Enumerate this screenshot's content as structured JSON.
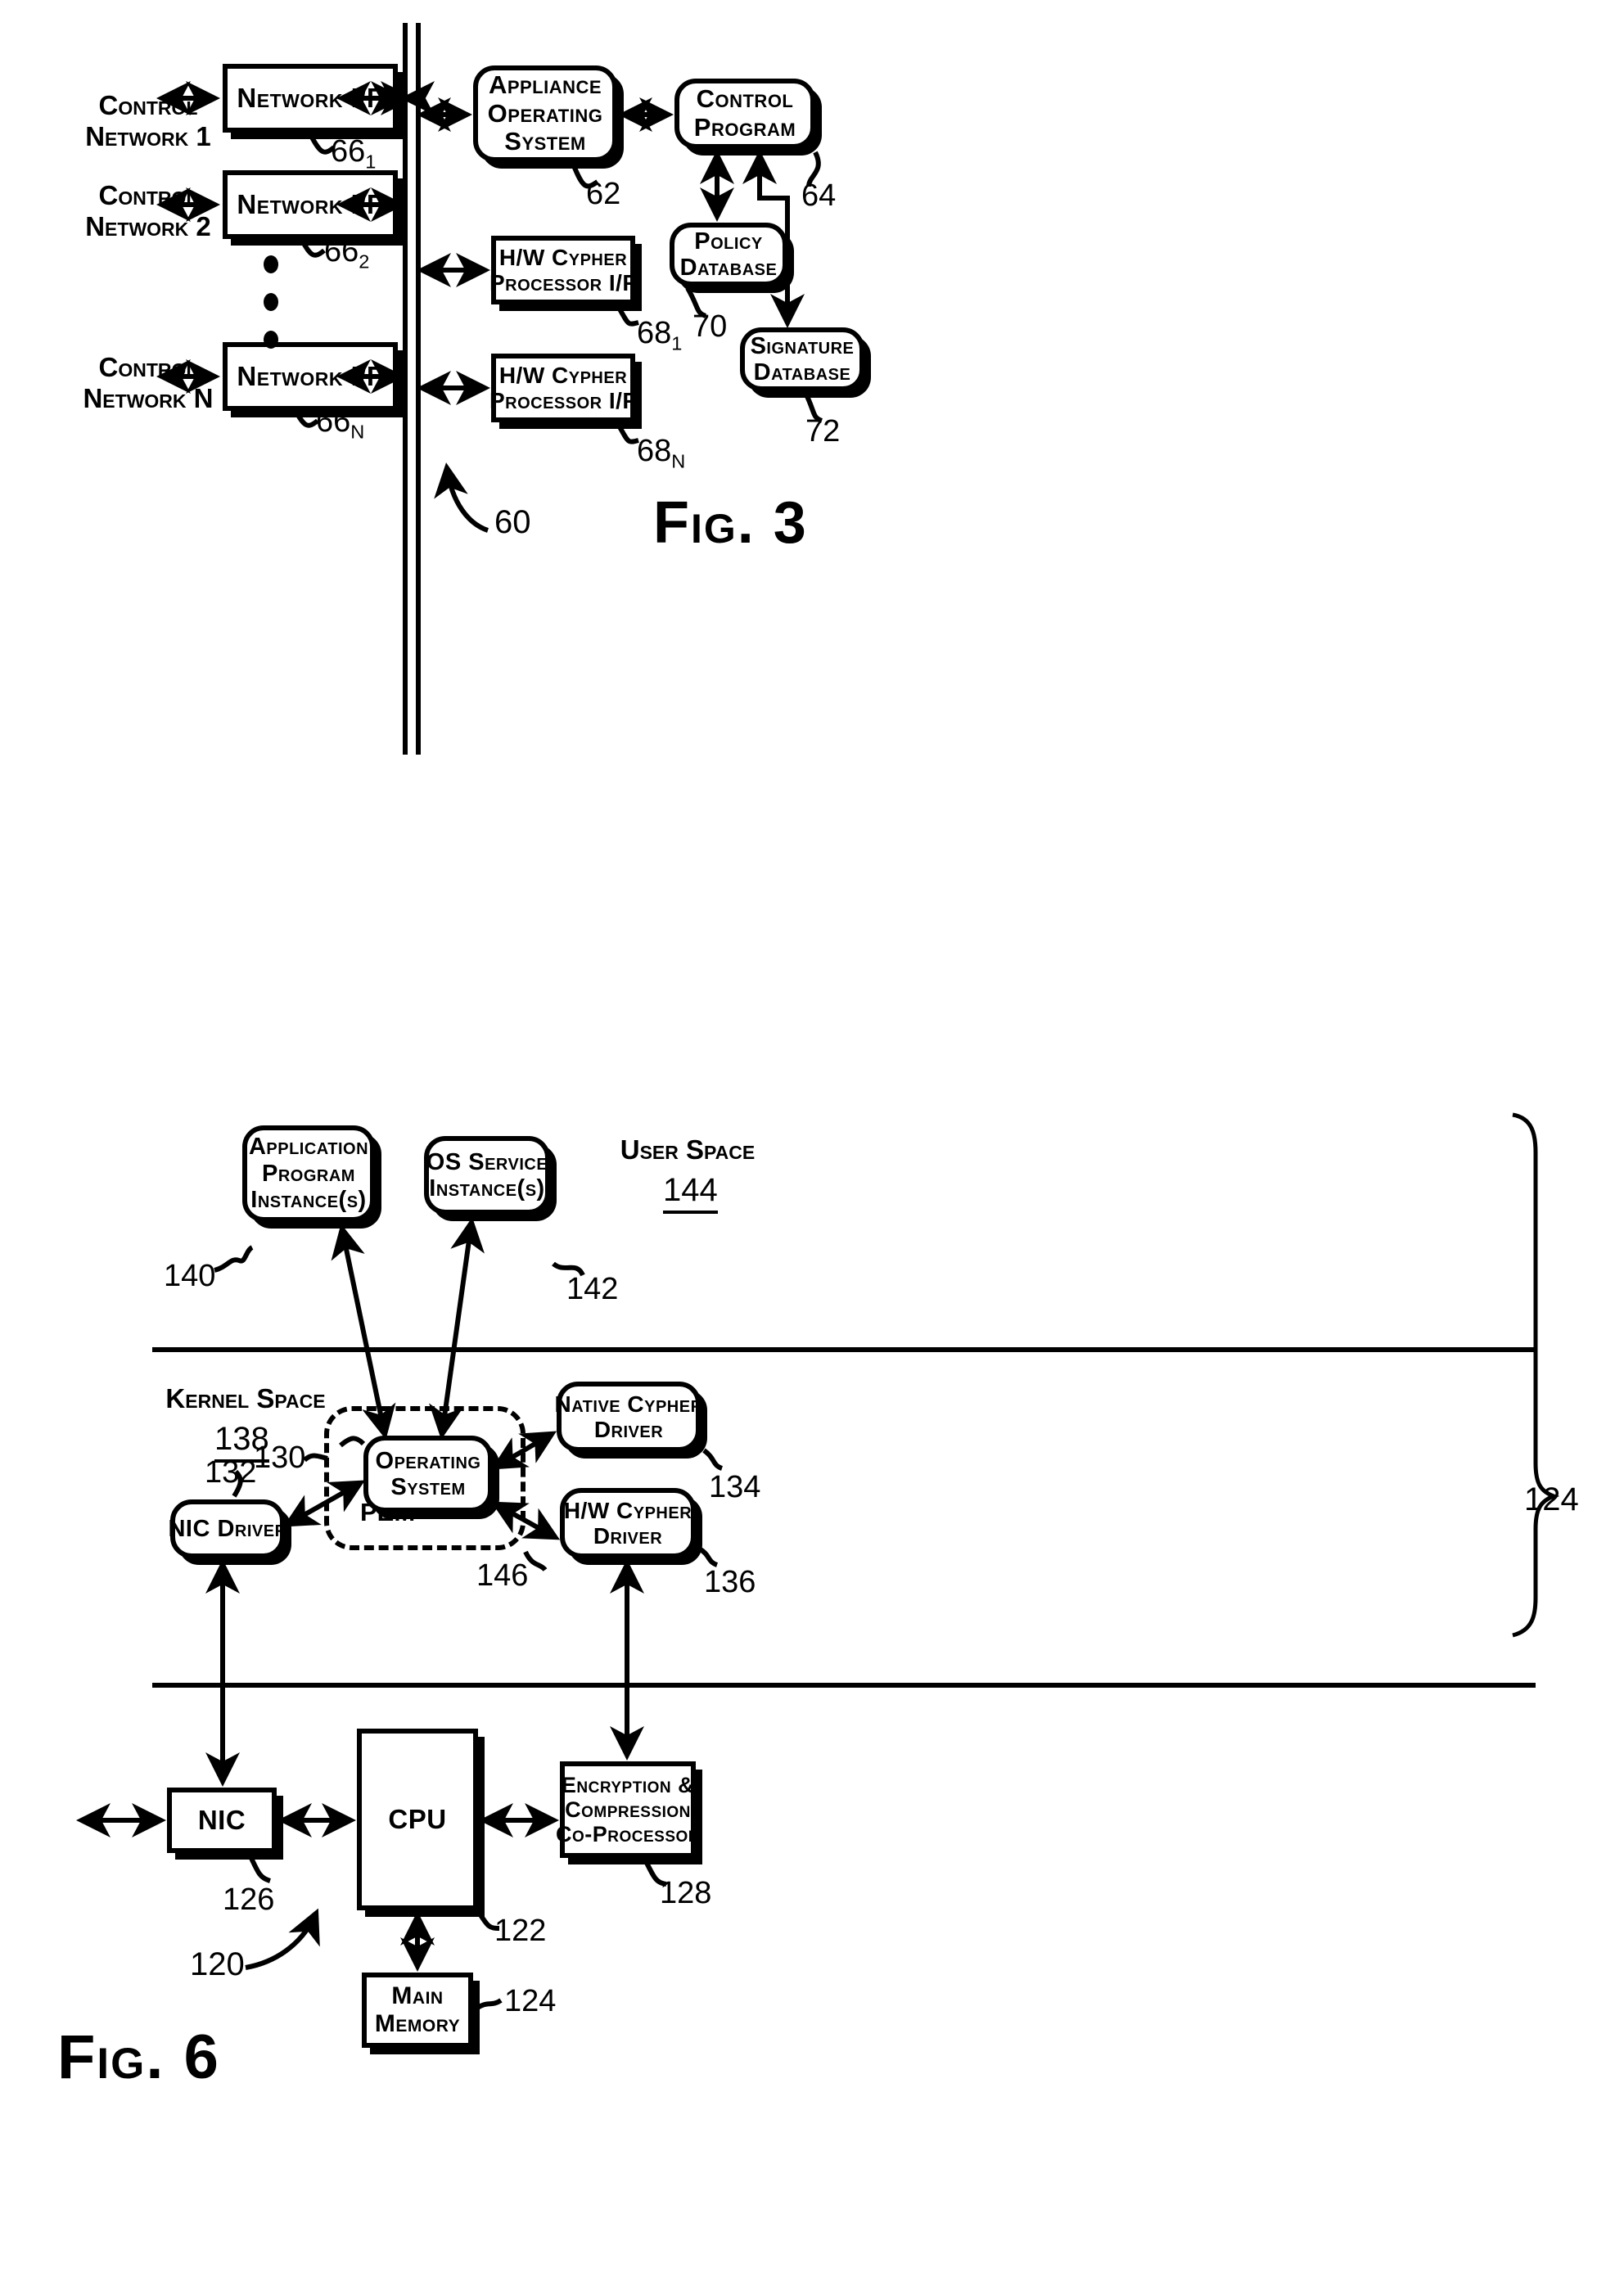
{
  "figures": [
    {
      "id": "fig3",
      "caption": "Fig. 3",
      "system_ref": "60",
      "left_labels": [
        {
          "line1": "Control",
          "line2": "Network 1"
        },
        {
          "line1": "Control",
          "line2": "Network 2"
        },
        {
          "line1": "Control",
          "line2": "Network N"
        }
      ],
      "network_if": [
        {
          "label": "Network I/F",
          "ref": "66",
          "sub": "1"
        },
        {
          "label": "Network I/F",
          "ref": "66",
          "sub": "2"
        },
        {
          "label": "Network I/F",
          "ref": "66",
          "sub": "N"
        }
      ],
      "blocks": {
        "appliance_os": {
          "line1": "Appliance",
          "line2": "Operating",
          "line3": "System",
          "ref": "62"
        },
        "control_program": {
          "line1": "Control",
          "line2": "Program",
          "ref": "64"
        },
        "policy_database": {
          "line1": "Policy",
          "line2": "Database",
          "ref": "70"
        },
        "signature_database": {
          "line1": "Signature",
          "line2": "Database",
          "ref": "72"
        },
        "hw_cypher_1": {
          "line1": "H/W Cypher",
          "line2": "Processor I/F",
          "ref": "68",
          "sub": "1"
        },
        "hw_cypher_n": {
          "line1": "H/W Cypher",
          "line2": "Processor I/F",
          "ref": "68",
          "sub": "N"
        }
      }
    },
    {
      "id": "fig6",
      "caption": "Fig. 6",
      "system_ref": "120",
      "zones": [
        {
          "name": "User Space",
          "ref": "144"
        },
        {
          "name": "Kernel Space",
          "ref": "138"
        }
      ],
      "brace_ref": "124",
      "blocks": {
        "app_program": {
          "line1": "Application",
          "line2": "Program",
          "line3": "Instance(s)",
          "ref": "140"
        },
        "os_service": {
          "line1": "OS Service",
          "line2": "Instance(s)",
          "ref": "142"
        },
        "operating_system": {
          "line1": "Operating",
          "line2": "System",
          "ref": "130"
        },
        "pem": {
          "label": "PEM",
          "ref": "146"
        },
        "nic_driver": {
          "line1": "NIC Driver",
          "ref": "132"
        },
        "native_cypher_driver": {
          "line1": "Native Cypher",
          "line2": "Driver",
          "ref": "134"
        },
        "hw_cypher_driver": {
          "line1": "H/W Cypher",
          "line2": "Driver",
          "ref": "136"
        },
        "nic": {
          "line1": "NIC",
          "ref": "126"
        },
        "cpu": {
          "line1": "CPU",
          "ref": "122"
        },
        "coprocessor": {
          "line1": "Encryption &",
          "line2": "Compression",
          "line3": "Co-Processor",
          "ref": "128"
        },
        "main_memory": {
          "line1": "Main",
          "line2": "Memory",
          "ref": "124"
        }
      }
    }
  ],
  "colors": {
    "ink": "#000000",
    "paper": "#ffffff"
  }
}
